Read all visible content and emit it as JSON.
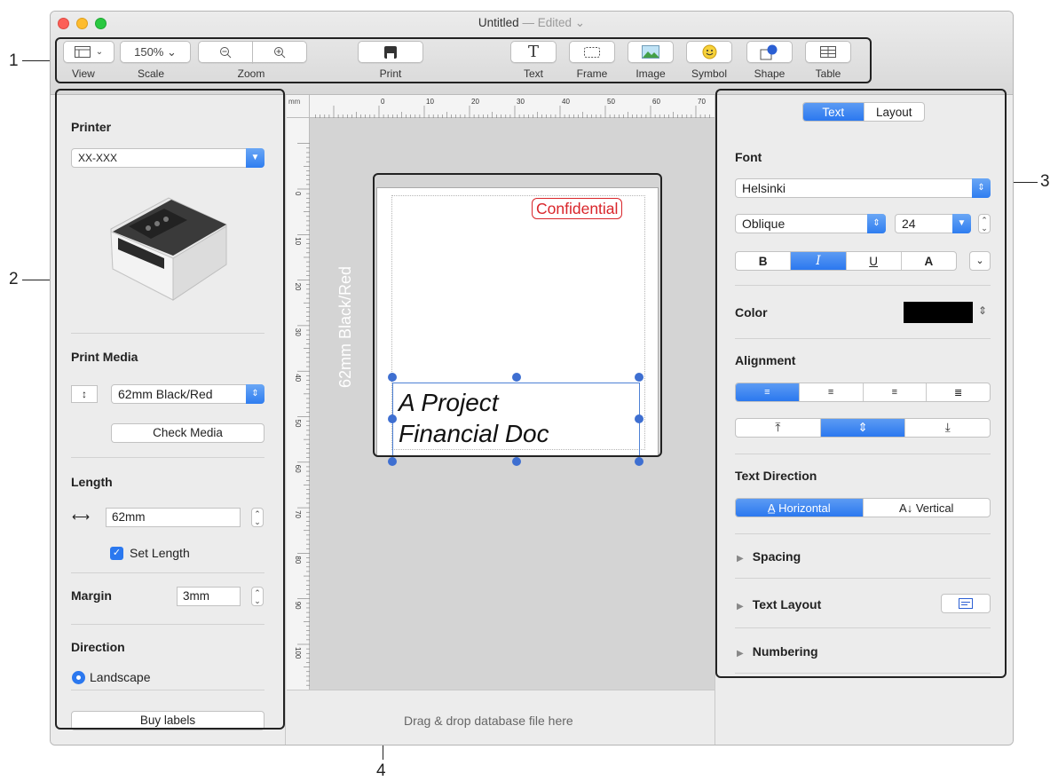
{
  "window": {
    "title": "Untitled",
    "title_sep": " — ",
    "edited": "Edited ⌄"
  },
  "callouts": {
    "toolbar": "1",
    "left_panel": "2",
    "right_panel": "3",
    "label": "4"
  },
  "toolbar": {
    "view_label": "View",
    "scale_value": "150% ⌄",
    "scale_label": "Scale",
    "zoom_label": "Zoom",
    "print_label": "Print",
    "text_label": "Text",
    "frame_label": "Frame",
    "image_label": "Image",
    "symbol_label": "Symbol",
    "shape_label": "Shape",
    "table_label": "Table"
  },
  "left": {
    "printer_title": "Printer",
    "printer_value": "XX-XXX",
    "print_media_title": "Print Media",
    "media_value": "62mm Black/Red",
    "check_media": "Check Media",
    "length_title": "Length",
    "length_value": "62mm",
    "set_length": "Set Length",
    "margin_title": "Margin",
    "margin_value": "3mm",
    "direction_title": "Direction",
    "landscape": "Landscape",
    "buy_labels": "Buy labels"
  },
  "canvas": {
    "ruler_unit": "mm",
    "h_ticks": [
      "0",
      "10",
      "20",
      "30",
      "40",
      "50",
      "60",
      "70"
    ],
    "v_ticks": [
      "0",
      "10",
      "20",
      "30",
      "40",
      "50",
      "60",
      "70",
      "80",
      "90",
      "100"
    ],
    "media_vertical": "62mm Black/Red",
    "confidential": "Confidential",
    "text_line1": "A Project",
    "text_line2": "Financial Doc",
    "drop_hint": "Drag & drop database file here"
  },
  "right": {
    "tabs": [
      "Text",
      "Layout"
    ],
    "font_title": "Font",
    "font_family": "Helsinki",
    "font_style": "Oblique",
    "font_size": "24",
    "style_buttons": [
      "B",
      "I",
      "U",
      "A"
    ],
    "color_title": "Color",
    "color_value": "#000000",
    "alignment_title": "Alignment",
    "text_direction_title": "Text Direction",
    "direction_options": [
      "A̲ Horizontal",
      "A↓ Vertical"
    ],
    "spacing": "Spacing",
    "text_layout": "Text Layout",
    "numbering": "Numbering"
  },
  "colors": {
    "accent": "#2b78ef",
    "confidential_red": "#d9252a",
    "selection": "#3e6fd1"
  }
}
